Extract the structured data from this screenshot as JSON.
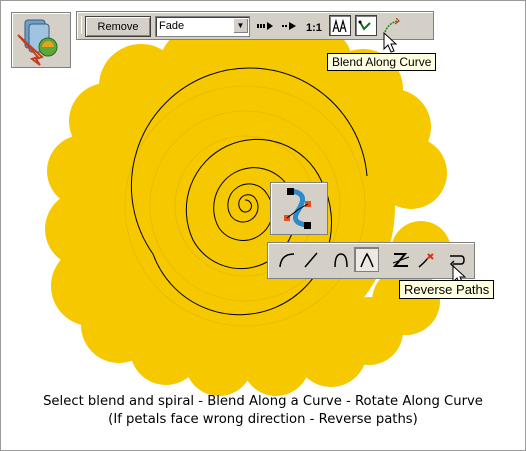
{
  "infobar": {
    "remove_label": "Remove",
    "blend_mode_value": "Fade",
    "tooltip": "Blend Along Curve"
  },
  "path_toolbar": {
    "tooltip": "Reverse Paths"
  },
  "caption": {
    "line1": "Select blend and spiral - Blend Along a Curve - Rotate Along Curve",
    "line2": "(If petals face wrong direction - Reverse paths)"
  },
  "colors": {
    "flower": "#f5c800",
    "flower_shadow": "#e9b800",
    "toolbar_face": "#d4d0c8",
    "tooltip_bg": "#ffffe1"
  },
  "icons": [
    "blend-tool-icon",
    "one-to-one-blend-icon",
    "two-to-one-blend-icon",
    "one-to-one-text-icon",
    "edit-blend-icon",
    "blend-along-curve-icon",
    "rotate-along-curve-icon",
    "bezier-path-icon",
    "curve-icon",
    "line-icon",
    "smooth-point-icon",
    "cusp-point-icon",
    "break-icon",
    "delete-point-icon",
    "reverse-paths-icon",
    "pointer-cursor-icon"
  ]
}
